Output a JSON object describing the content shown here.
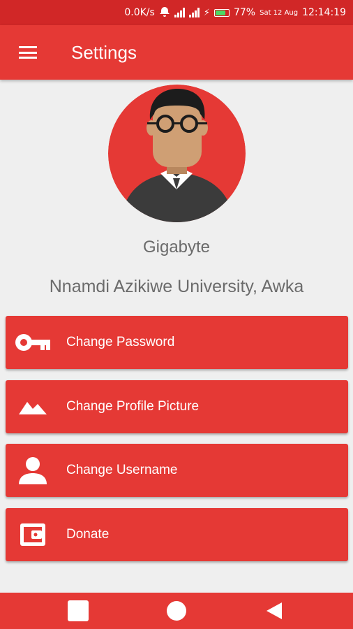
{
  "status_bar": {
    "speed": "0.0K/s",
    "battery_pct": "77%",
    "battery_level": 0.77,
    "date": "Sat 12 Aug",
    "time": "12:14:19",
    "color": "#d12727"
  },
  "app_bar": {
    "title": "Settings",
    "color": "#e53935",
    "menu_icon": "hamburger-menu-icon"
  },
  "profile": {
    "avatar_icon": "user-avatar-with-glasses",
    "name": "Gigabyte",
    "school": "Nnamdi Azikiwe University, Awka"
  },
  "actions": [
    {
      "label": "Change Password",
      "icon": "key-icon"
    },
    {
      "label": "Change Profile Picture",
      "icon": "image-icon"
    },
    {
      "label": "Change Username",
      "icon": "person-icon"
    },
    {
      "label": "Donate",
      "icon": "wallet-icon"
    }
  ],
  "nav_bar": {
    "recents_icon": "square-icon",
    "home_icon": "circle-icon",
    "back_icon": "triangle-back-icon"
  }
}
